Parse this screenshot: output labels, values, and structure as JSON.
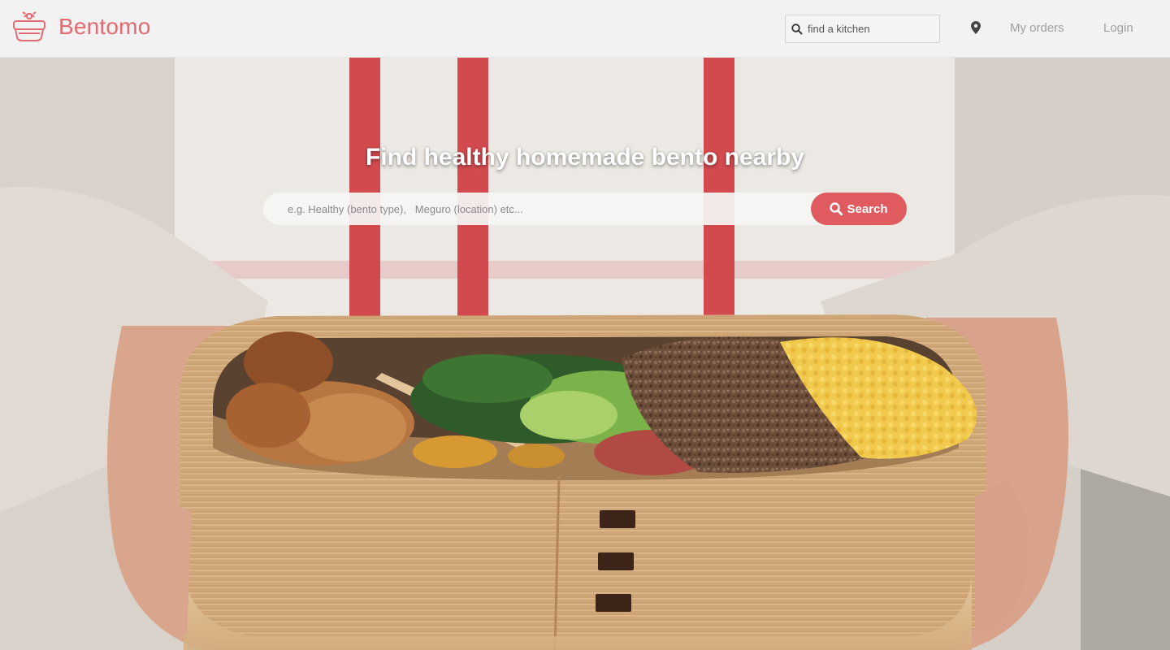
{
  "brand": {
    "name": "Bentomo",
    "icon": "bento-basket-icon",
    "color": "#e26b72"
  },
  "header": {
    "kitchen_search": {
      "placeholder": "find a kitchen",
      "icon": "search-icon"
    },
    "location_icon": "location-pin-icon",
    "nav": {
      "orders": "My orders",
      "login": "Login"
    }
  },
  "hero": {
    "title": "Find healthy homemade bento nearby",
    "search": {
      "placeholder": "e.g. Healthy (bento type),   Meguro (location) etc...",
      "button_label": "Search",
      "button_color": "#e05b5f"
    },
    "background_image": "hands-holding-wooden-bento-box-photo"
  }
}
